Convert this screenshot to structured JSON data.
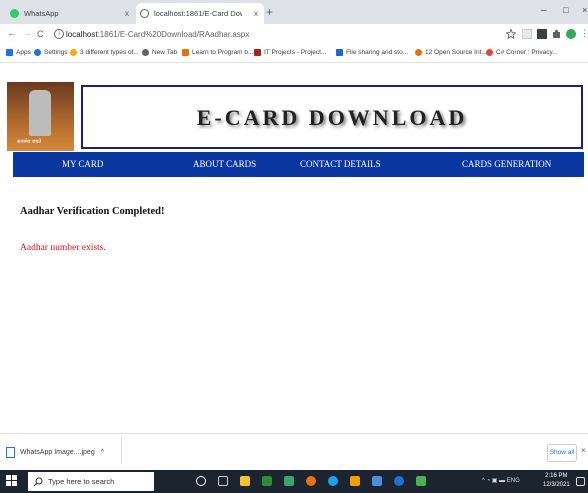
{
  "browser": {
    "tabs": [
      {
        "title": "WhatsApp",
        "favicon_color": "#25d366",
        "active": false
      },
      {
        "title": "localhost:1861/E-Card Downloa",
        "favicon_color": "#5f6368",
        "active": true
      }
    ],
    "new_tab_symbol": "+",
    "close_symbol": "x",
    "window_controls": {
      "minimize": "–",
      "maximize": "□",
      "close": "×"
    },
    "nav": {
      "back": "←",
      "forward": "→",
      "reload": "C"
    },
    "address": {
      "host": "localhost",
      "rest": ":1861/E-Card%20Download/RAadhar.aspx"
    },
    "bookmarks": [
      {
        "label": "Apps",
        "icon_color": "#1a73e8"
      },
      {
        "label": "Settings",
        "icon_color": "#1a73e8"
      },
      {
        "label": "3 different types of...",
        "icon_color": "#f9ab00"
      },
      {
        "label": "New Tab",
        "icon_color": "#5f6368"
      },
      {
        "label": "Learn to Program b...",
        "icon_color": "#e8710a"
      },
      {
        "label": "IT Projects - Project...",
        "icon_color": "#a52714"
      },
      {
        "label": "File sharing and sto...",
        "icon_color": "#1967d2"
      },
      {
        "label": "12 Open Source Int...",
        "icon_color": "#e8710a"
      },
      {
        "label": "C# Corner : Privacy...",
        "icon_color": "#ea4335"
      }
    ]
  },
  "page": {
    "emblem_text": "सत्यमेव जयते",
    "title": "E-CARD DOWNLOAD",
    "nav_items": [
      "MY CARD",
      "ABOUT CARDS",
      "CONTACT DETAILS",
      "CARDS GENERATION"
    ],
    "verification_heading": "Aadhar Verification Completed!",
    "result_message": "Aadhar number exists.",
    "nav_color": "#0a37a0",
    "message_color": "#e01010"
  },
  "download_bar": {
    "item": "WhatsApp Image....jpeg",
    "item_caret": "^",
    "show_all": "Show all",
    "close": "×"
  },
  "taskbar": {
    "search_placeholder": "Type here to search",
    "tray_text": "ENG",
    "time": "2:16 PM",
    "date": "12/3/2021"
  }
}
